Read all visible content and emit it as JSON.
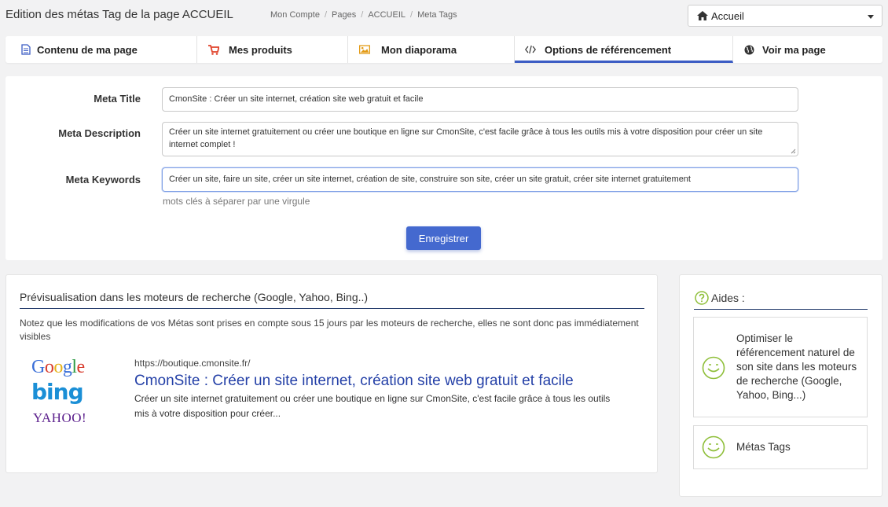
{
  "header": {
    "title": "Edition des métas Tag de la page ACCUEIL",
    "breadcrumb": [
      "Mon Compte",
      "Pages",
      "ACCUEIL",
      "Meta Tags"
    ],
    "page_select": {
      "selected": "Accueil",
      "icon": "home-icon"
    }
  },
  "tabs": [
    {
      "label": "Contenu de ma page",
      "icon": "document-icon",
      "active": false
    },
    {
      "label": "Mes produits",
      "icon": "cart-icon",
      "active": false
    },
    {
      "label": "Mon diaporama",
      "icon": "image-icon",
      "active": false
    },
    {
      "label": "Options de référencement",
      "icon": "code-icon",
      "active": true
    },
    {
      "label": "Voir ma page",
      "icon": "globe-icon",
      "active": false
    }
  ],
  "form": {
    "meta_title": {
      "label": "Meta Title",
      "value": "CmonSite : Créer un site internet, création site web gratuit et facile"
    },
    "meta_description": {
      "label": "Meta Description",
      "value": "Créer un site internet gratuitement ou créer une boutique en ligne sur CmonSite, c'est facile grâce à tous les outils mis à votre disposition pour créer un site internet complet !"
    },
    "meta_keywords": {
      "label": "Meta Keywords",
      "value": "Créer un site, faire un site, créer un site internet, création de site, construire son site, créer un site gratuit, créer site internet gratuitement"
    },
    "keywords_help": "mots clés à séparer par une virgule",
    "save_label": "Enregistrer"
  },
  "preview": {
    "title": "Prévisualisation dans les moteurs de recherche (Google, Yahoo, Bing..)",
    "note": "Notez que les modifications de vos Métas sont prises en compte sous 15 jours par les moteurs de recherche, elles ne sont donc pas immédiatement visibles",
    "logos": {
      "google": "Google",
      "bing": "bing",
      "yahoo": "YAHOO!"
    },
    "result": {
      "url": "https://boutique.cmonsite.fr/",
      "title": "CmonSite : Créer un site internet, création site web gratuit et facile",
      "description": "Créer un site internet gratuitement ou créer une boutique en ligne sur CmonSite, c'est facile grâce à tous les outils mis à votre disposition pour créer..."
    }
  },
  "help": {
    "title": "Aides :",
    "items": [
      {
        "label": "Optimiser le référencement naturel de son site dans les moteurs de recherche (Google, Yahoo, Bing...)"
      },
      {
        "label": "Métas Tags"
      }
    ]
  },
  "colors": {
    "accent": "#3b5cc4",
    "button": "#4469cf",
    "link": "#2440a7",
    "help_green": "#8fbf3a",
    "rule": "#223a6b"
  }
}
